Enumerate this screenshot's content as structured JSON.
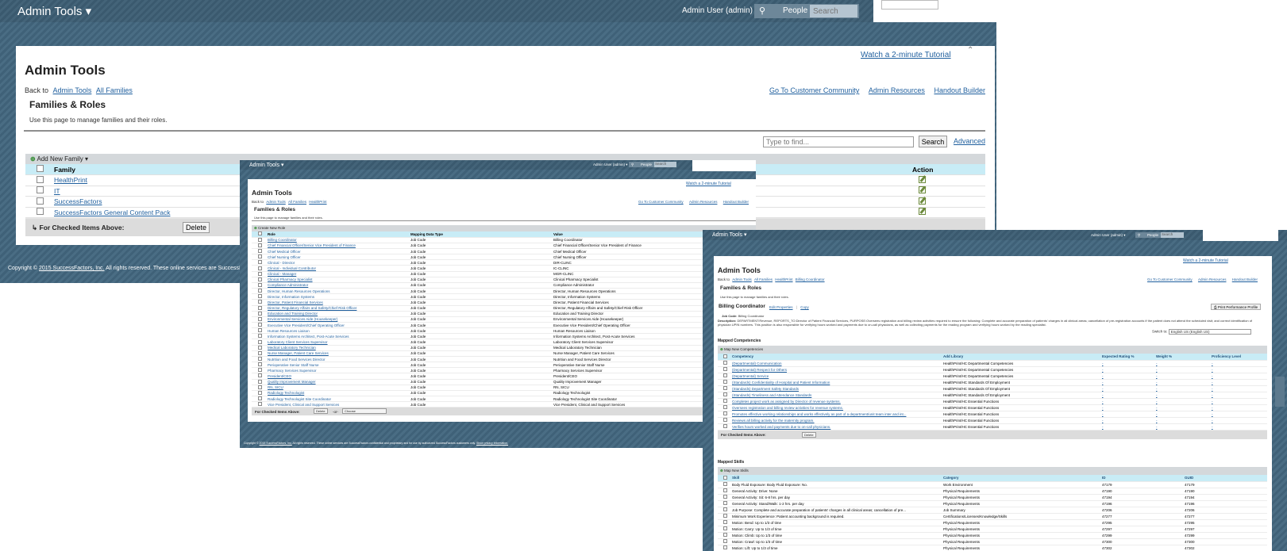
{
  "w1": {
    "app_menu": "Admin Tools ▾",
    "user_menu": "Admin User (admin) ▾",
    "people_label": "People",
    "search_placeholder": "Search",
    "tutorial": "Watch a 2-minute Tutorial",
    "page_title": "Admin Tools",
    "back_to": "Back to",
    "crumbs": [
      "Admin Tools",
      "All Families"
    ],
    "right_links": [
      "Go To Customer Community",
      "Admin Resources",
      "Handout Builder"
    ],
    "section_title": "Families & Roles",
    "description": "Use this page to manage families and their roles.",
    "find_placeholder": "Type to find...",
    "search_button": "Search",
    "advanced_link": "Advanced",
    "add_new_family": "Add New Family ▾",
    "col_family": "Family",
    "col_action": "Action",
    "families": [
      "HealthPrint",
      "IT",
      "SuccessFactors",
      "SuccessFactors General Content Pack"
    ],
    "checked_label": "For Checked Items Above:",
    "delete_button": "Delete",
    "copyright": "Copyright ©",
    "copyright_link": "2015 SuccessFactors, Inc.",
    "copyright_rest": "All rights reserved. These online services are SuccessFa"
  },
  "w2": {
    "app_menu": "Admin Tools ▾",
    "user_menu": "Admin User (admin) ▾",
    "people_label": "People",
    "search_placeholder": "Search",
    "tutorial": "Watch a 2-minute Tutorial",
    "page_title": "Admin Tools",
    "back_to": "Back to",
    "crumbs": [
      "Admin Tools",
      "All Families",
      "HealthPrint"
    ],
    "right_links": [
      "Go To Customer Community",
      "Admin Resources",
      "Handout Builder"
    ],
    "section_title": "Families & Roles",
    "description": "Use this page to manage families and their roles.",
    "create_role": "Create New Role",
    "columns": [
      "Role",
      "Mapping Data Type",
      "Value"
    ],
    "roles": [
      [
        "Billing Coordinator",
        "Job Code",
        "Billing Coordinator"
      ],
      [
        "Chief Financial Officer/Senior Vice President of Finance",
        "Job Code",
        "Chief Financial Officer/Senior Vice President of Finance"
      ],
      [
        "Chief Medical Officer",
        "Job Code",
        "Chief Medical Officer"
      ],
      [
        "Chief Nursing Officer",
        "Job Code",
        "Chief Nursing Officer"
      ],
      [
        "Clinical - Director",
        "Job Code",
        "DIR-CLINC"
      ],
      [
        "Clinical - Individual Contributor",
        "Job Code",
        "IC-CLINC"
      ],
      [
        "Clinical - Manager",
        "Job Code",
        "MGR-CLINC"
      ],
      [
        "Clinical Pharmacy Specialist",
        "Job Code",
        "Clinical Pharmacy Specialist"
      ],
      [
        "Compliance Administrator",
        "Job Code",
        "Compliance Administrator"
      ],
      [
        "Director, Human Resources Operations",
        "Job Code",
        "Director, Human Resources Operations"
      ],
      [
        "Director, Information Systems",
        "Job Code",
        "Director, Information Systems"
      ],
      [
        "Director, Patient Financial Services",
        "Job Code",
        "Director, Patient Financial Services"
      ],
      [
        "Director, Regulatory Affairs and Safety/Chief Risk Officer",
        "Job Code",
        "Director, Regulatory Affairs and Safety/Chief Risk Officer"
      ],
      [
        "Education and Training Director",
        "Job Code",
        "Education and Training Director"
      ],
      [
        "Environmental Services Aide (Housekeeper)",
        "Job Code",
        "Environmental Services Aide (Housekeeper)"
      ],
      [
        "Executive Vice President/Chief Operating Officer",
        "Job Code",
        "Executive Vice President/Chief Operating Officer"
      ],
      [
        "Human Resources Liaison",
        "Job Code",
        "Human Resources Liaison"
      ],
      [
        "Information Systems Architect, Post-Acute Services",
        "Job Code",
        "Information Systems Architect, Post-Acute Services"
      ],
      [
        "Laboratory Client Services Supervisor",
        "Job Code",
        "Laboratory Client Services Supervisor"
      ],
      [
        "Medical Laboratory Technician",
        "Job Code",
        "Medical Laboratory Technician"
      ],
      [
        "Nurse Manager, Patient Care Services",
        "Job Code",
        "Nurse Manager, Patient Care Services"
      ],
      [
        "Nutrition and Food Services Director",
        "Job Code",
        "Nutrition and Food Services Director"
      ],
      [
        "Perioperative Senior Staff Nurse",
        "Job Code",
        "Perioperative Senior Staff Nurse"
      ],
      [
        "Pharmacy Services Supervisor",
        "Job Code",
        "Pharmacy Services Supervisor"
      ],
      [
        "President/CEO",
        "Job Code",
        "President/CEO"
      ],
      [
        "Quality Improvement Manager",
        "Job Code",
        "Quality Improvement Manager"
      ],
      [
        "RN, SICU",
        "Job Code",
        "RN, SICU"
      ],
      [
        "Radiology Technologist",
        "Job Code",
        "Radiology Technologist"
      ],
      [
        "Radiology Technologist Site Coordinator",
        "Job Code",
        "Radiology Technologist Site Coordinator"
      ],
      [
        "Vice President, Clinical and Support Services",
        "Job Code",
        "Vice President, Clinical and Support Services"
      ]
    ],
    "checked_label": "For Checked Items Above:",
    "delete_button": "Delete",
    "or_label": "-or-",
    "choose_label": "Choose",
    "copyright": "Copyright ©",
    "copyright_link": "2015 SuccessFactors, Inc.",
    "copyright_rest": "All rights reserved. These online services are SuccessFactors confidential and proprietary and for use by authorized SuccessFactors customers only.",
    "privacy_link": "Show privacy information."
  },
  "w3": {
    "app_menu": "Admin Tools ▾",
    "user_menu": "Admin User (admin) ▾",
    "people_label": "People",
    "search_placeholder": "Search",
    "tutorial": "Watch a 2-minute Tutorial",
    "page_title": "Admin Tools",
    "back_to": "Back to",
    "crumbs": [
      "Admin Tools",
      "All Families",
      "HealthPrint",
      "Billing Coordinator"
    ],
    "right_links": [
      "Go To Customer Community",
      "Admin Resources",
      "Handout Builder"
    ],
    "section_title": "Families & Roles",
    "description": "Use this page to manage families and their roles.",
    "role_name": "Billing Coordinator",
    "edit_properties": "Edit Properties",
    "copy": "Copy",
    "print_profile": "Print Performance Profile",
    "job_code_label": "Job Code:",
    "job_code_value": "Billing Coordinator",
    "description_label": "Description:",
    "description_text": "DEPARTMENT:Revenue, REPORTS_TO:Director of Patient Financial Services, PURPOSE:Oversees registration and billing review activities required to ensure the following: Complete and accurate preparation of patients' charges in all clinical areas; cancellation of pre-registration accounts if the patient does not attend the scheduled visit; and correct identification of physician UPIN numbers. This position is also responsible for verifying hours worked and payments due to on-call physicians, as well as collecting payments for the reading program and verifying hours worked by the reading specialist.",
    "switch_to": "Switch to:",
    "switch_value": "English US (English US)",
    "mapped_competencies": "Mapped Competencies",
    "map_new_competencies": "Map New Competencies",
    "comp_columns": [
      "Competency",
      "Add Library",
      "Expected Rating %",
      "Weight %",
      "Proficiency Level"
    ],
    "competencies": [
      [
        "(Departmental) Communication",
        "HealthPrint/HC Departmental Competencies",
        "-",
        "-",
        "-"
      ],
      [
        "(Departmental) Respect for Others",
        "HealthPrint/HC Departmental Competencies",
        "-",
        "-",
        "-"
      ],
      [
        "(Departmental) Service",
        "HealthPrint/HC Departmental Competencies",
        "-",
        "-",
        "-"
      ],
      [
        "(Standards) Confidentiality of Hospital and Patient Information",
        "HealthPrint/HC Standards Of Employment",
        "-",
        "-",
        "-"
      ],
      [
        "(Standards) Department Safety Standards",
        "HealthPrint/HC Standards Of Employment",
        "-",
        "-",
        "-"
      ],
      [
        "(Standards) Timeliness and Attendance Standards",
        "HealthPrint/HC Standards Of Employment",
        "-",
        "-",
        "-"
      ],
      [
        "Completes project work as assigned by Director of revenue systems.",
        "HealthPrint/HC Essential Functions",
        "-",
        "-",
        "-"
      ],
      [
        "Oversees registration and billing review activities for revenue systems.",
        "HealthPrint/HC Essential Functions",
        "-",
        "-",
        "-"
      ],
      [
        "Promotes effective working relationships and works effectively as part of a department/unit team inter and int...",
        "HealthPrint/HC Essential Functions",
        "-",
        "-",
        "-"
      ],
      [
        "Reviews all billing activity for the maternity program.",
        "HealthPrint/HC Essential Functions",
        "-",
        "-",
        "-"
      ],
      [
        "Verifies hours worked and payments due to on-call physicians.",
        "HealthPrint/HC Essential Functions",
        "-",
        "-",
        "-"
      ]
    ],
    "checked_label": "For Checked Items Above:",
    "delete_button": "Delete",
    "mapped_skills": "Mapped Skills",
    "map_new_skills": "Map New Skills",
    "skill_columns": [
      "Skill",
      "Category",
      "ID",
      "GUID"
    ],
    "skills": [
      [
        "Body Fluid Exposure: Body Fluid Exposure: No.",
        "Work Environment",
        "47179",
        "47179"
      ],
      [
        "General Activity: Drive: None",
        "Physical Requirements",
        "47190",
        "47190"
      ],
      [
        "General Activity: Sit: 6-8 hrs. per day",
        "Physical Requirements",
        "47194",
        "47194"
      ],
      [
        "General Activity: Stand/Walk: 1-2 hrs. per day",
        "Physical Requirements",
        "47196",
        "47196"
      ],
      [
        "Job Purpose: Complete and accurate preparation of patients' charges in all clinical areas; cancellation of pre...",
        "Job Summary",
        "47206",
        "47206"
      ],
      [
        "Minimum Work Experience: Patient accounting background is required.",
        "Certifications/Licenses/Knowledge/Skills",
        "47277",
        "47277"
      ],
      [
        "Motion: Bend: Up to 1/3 of time",
        "Physical Requirements",
        "47295",
        "47295"
      ],
      [
        "Motion: Carry: Up to 1/3 of time",
        "Physical Requirements",
        "47297",
        "47297"
      ],
      [
        "Motion: Climb: Up to 1/3 of time",
        "Physical Requirements",
        "47299",
        "47299"
      ],
      [
        "Motion: Crawl: Up to 1/3 of time",
        "Physical Requirements",
        "47300",
        "47300"
      ],
      [
        "Motion: Lift: Up to 1/3 of time",
        "Physical Requirements",
        "47302",
        "47302"
      ]
    ]
  }
}
